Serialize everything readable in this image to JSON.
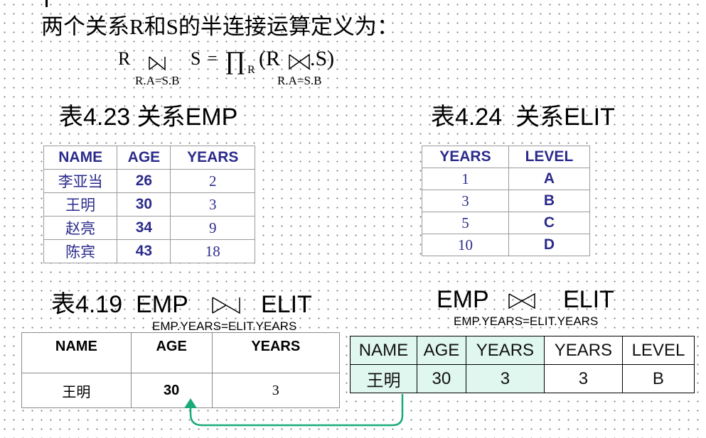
{
  "title": "两个关系R和S的半连接运算定义为：",
  "formula": {
    "lhs_r": "R",
    "lhs_s": "S",
    "equals": "=",
    "pi": "∏",
    "pi_sub": "R",
    "rhs_open": "(R",
    "rhs_close": ".S)",
    "lhs_cond": "R.A=S.B",
    "rhs_cond": "R.A=S.B"
  },
  "emp": {
    "caption": "表4.23 关系EMP",
    "headers": [
      "NAME",
      "AGE",
      "YEARS"
    ],
    "rows": [
      [
        "李亚当",
        "26",
        "2"
      ],
      [
        "王明",
        "30",
        "3"
      ],
      [
        "赵亮",
        "34",
        "9"
      ],
      [
        "陈宾",
        "43",
        "18"
      ]
    ]
  },
  "elit": {
    "caption": "表4.24  关系ELIT",
    "headers": [
      "YEARS",
      "LEVEL"
    ],
    "rows": [
      [
        "1",
        "A"
      ],
      [
        "3",
        "B"
      ],
      [
        "5",
        "C"
      ],
      [
        "10",
        "D"
      ]
    ]
  },
  "semijoin": {
    "caption_left": "表4.19  EMP",
    "caption_right": "ELIT",
    "condition": "EMP.YEARS=ELIT.YEARS",
    "headers": [
      "NAME",
      "AGE",
      "YEARS"
    ],
    "row": [
      "王明",
      "30",
      "3"
    ]
  },
  "join": {
    "caption_left": "EMP",
    "caption_right": "ELIT",
    "condition": "EMP.YEARS=ELIT.YEARS",
    "headers": [
      "NAME",
      "AGE",
      "YEARS",
      "YEARS",
      "LEVEL"
    ],
    "row": [
      "王明",
      "30",
      "3",
      "3",
      "B"
    ]
  },
  "colors": {
    "accent": "#2b2b8c",
    "highlight": "#dff7ee",
    "arrow": "#1aaa7a"
  }
}
